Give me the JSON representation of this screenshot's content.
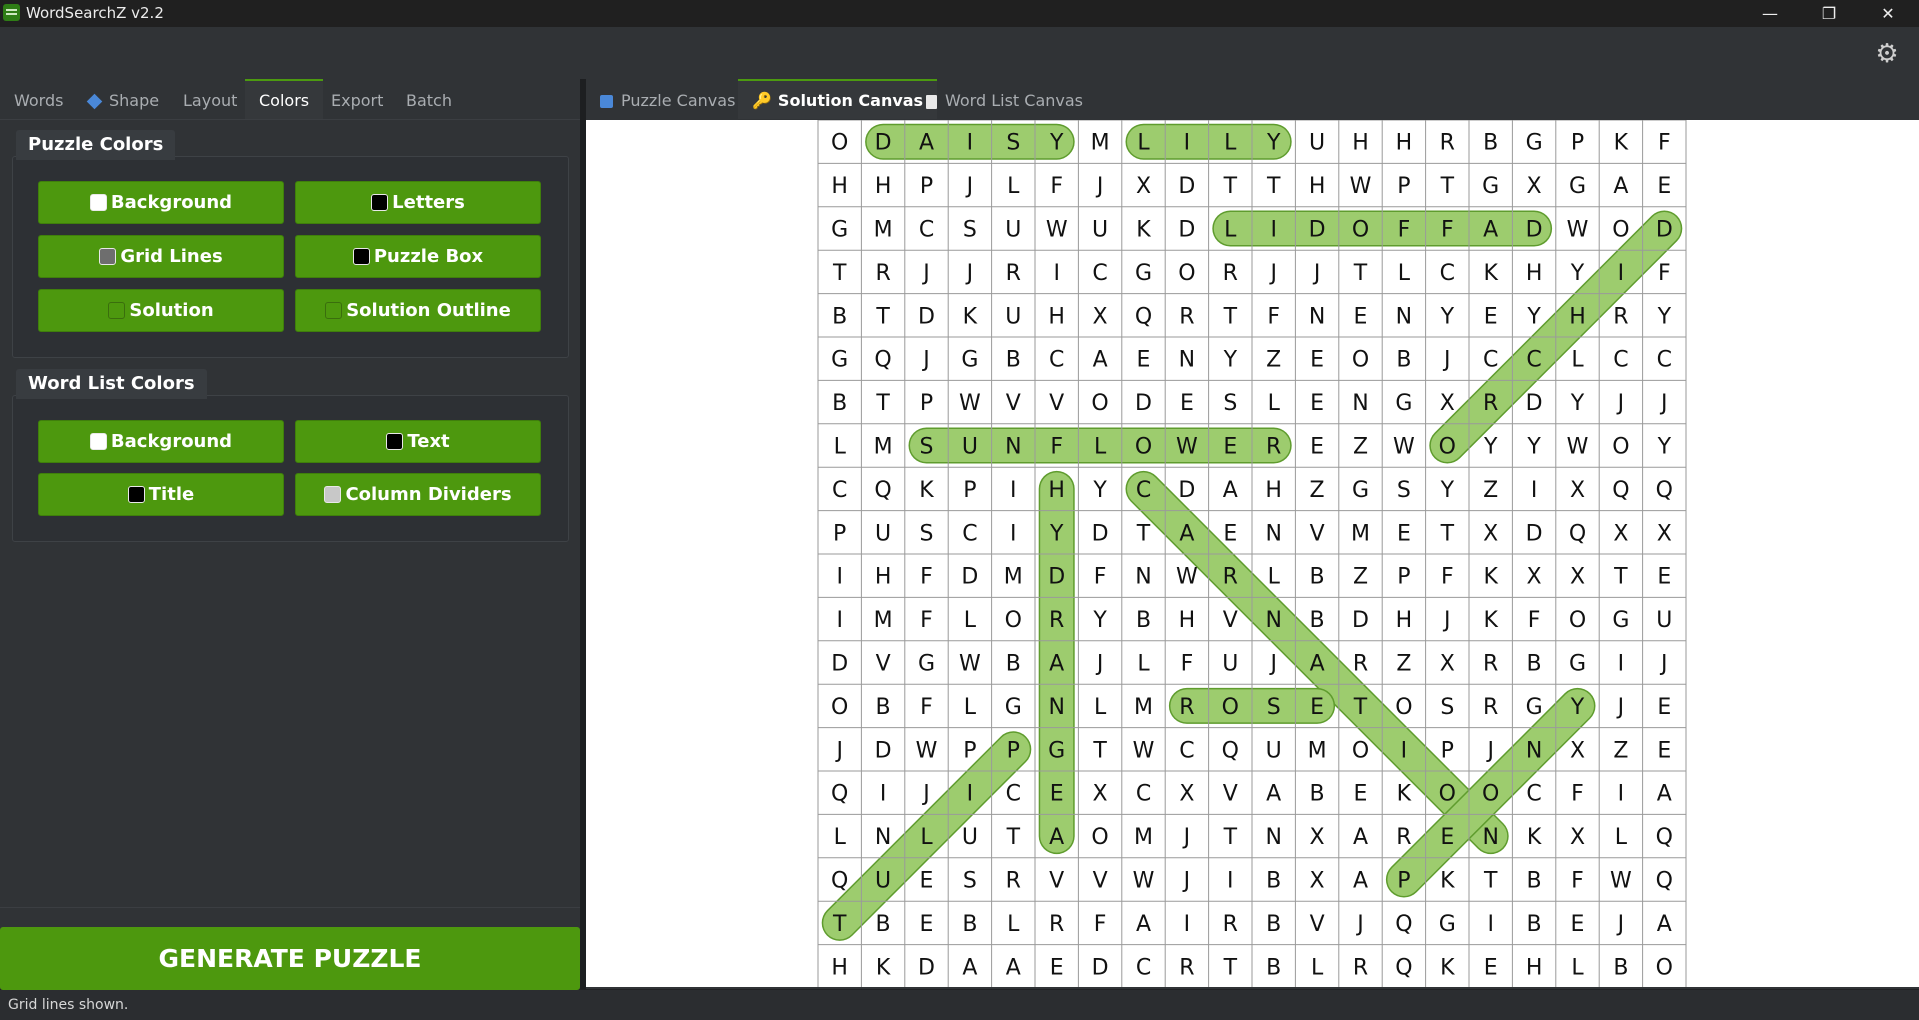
{
  "window": {
    "title": "WordSearchZ v2.2",
    "minimize_glyph": "—",
    "restore_glyph": "❐",
    "close_glyph": "✕",
    "settings_icon": "⚙"
  },
  "left_tabs": [
    "Words",
    "Shape",
    "Layout",
    "Colors",
    "Export",
    "Batch"
  ],
  "active_left_tab": "Colors",
  "puzzle_colors": {
    "title": "Puzzle Colors",
    "buttons": [
      {
        "label": "Background",
        "swatch": "#ffffff"
      },
      {
        "label": "Letters",
        "swatch": "#000000"
      },
      {
        "label": "Grid Lines",
        "swatch": "#6e6e6e"
      },
      {
        "label": "Puzzle Box",
        "swatch": "#000000"
      },
      {
        "label": "Solution",
        "swatch": "#4d980e"
      },
      {
        "label": "Solution Outline",
        "swatch": "#4d980e"
      }
    ]
  },
  "word_list_colors": {
    "title": "Word List Colors",
    "buttons": [
      {
        "label": "Background",
        "swatch": "#ffffff"
      },
      {
        "label": "Text",
        "swatch": "#000000"
      },
      {
        "label": "Title",
        "swatch": "#000000"
      },
      {
        "label": "Column Dividers",
        "swatch": "#c8c8c8"
      }
    ]
  },
  "generate_label": "GENERATE PUZZLE",
  "right_tabs": [
    "Puzzle Canvas",
    "Solution Canvas",
    "Word List Canvas"
  ],
  "active_right_tab": "Solution Canvas",
  "status_text": "Grid lines shown.",
  "colors": {
    "accent": "#4d980e",
    "highlight_fill": "#9dcc6e",
    "highlight_stroke": "#5f9c2e"
  },
  "puzzle": {
    "rows": [
      "ODAISYMLILYUHHRBGPKF",
      "HHPJLFJXDTTHWPTGXGAE",
      "GMCSUWUKDLIDOFFADWOD",
      "TRJJRICGORJJTLCKHYIF",
      "BTDKUHXQRTFNENYEYHRY",
      "GQJGBCAENYZEOBJCCLCC",
      "BTPWVVODESLENGXRDYJJ",
      "LMSUNFLOWEREZWOYYWOY",
      "CQKPIHYCDAHZGSYZIXQQ",
      "PUSCIYDTAENVMETXDQXX",
      "IHFDMDFNWRLBZPFKXXTE",
      "IMFLORYBHVNBDHJKFOGU",
      "DVGWBAJLFUJARZXRBGIJ",
      "OBFLGNLMROSETOSRGYJE",
      "JDWPPGTWCQUMOIPJNXZE",
      "QIJICEXCXVABEKOOCFIA",
      "LNLUTAOMJTNXARENKXLQ",
      "QUESRVVWJIBXAPKTBFWQ",
      "TBEBLRFAIRBVJQGIBEJA",
      "HKDAAEDCRTBLRQKEHLBO"
    ],
    "solutions": [
      {
        "word": "DAISY",
        "start": [
          0,
          1
        ],
        "end": [
          0,
          5
        ]
      },
      {
        "word": "LILY",
        "start": [
          0,
          7
        ],
        "end": [
          0,
          10
        ]
      },
      {
        "word": "DAFFODIL",
        "start": [
          2,
          16
        ],
        "end": [
          2,
          9
        ]
      },
      {
        "word": "ORCHID",
        "start": [
          7,
          14
        ],
        "end": [
          2,
          19
        ]
      },
      {
        "word": "SUNFLOWER",
        "start": [
          7,
          2
        ],
        "end": [
          7,
          10
        ]
      },
      {
        "word": "HYDRANGEA",
        "start": [
          8,
          5
        ],
        "end": [
          16,
          5
        ]
      },
      {
        "word": "CARNATION",
        "start": [
          8,
          7
        ],
        "end": [
          16,
          15
        ]
      },
      {
        "word": "ROSE",
        "start": [
          13,
          8
        ],
        "end": [
          13,
          11
        ]
      },
      {
        "word": "PEONY",
        "start": [
          17,
          13
        ],
        "end": [
          13,
          17
        ]
      },
      {
        "word": "TULIP",
        "start": [
          18,
          0
        ],
        "end": [
          14,
          4
        ]
      }
    ]
  }
}
